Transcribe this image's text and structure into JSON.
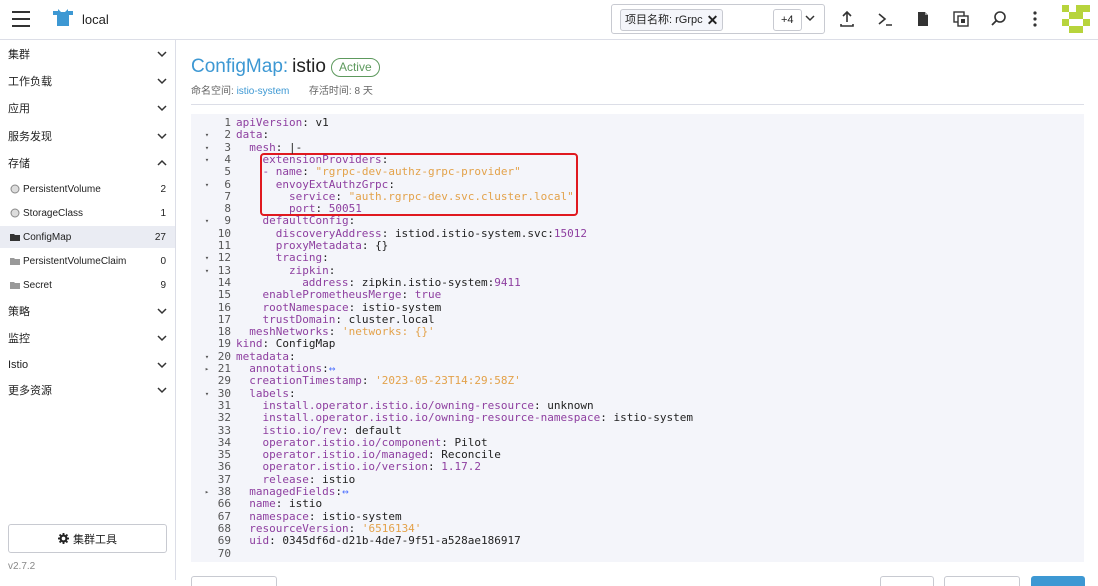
{
  "header": {
    "cluster_name": "local",
    "namespace_chip": "项目名称: rGrpc",
    "namespace_more": "+4"
  },
  "sidebar": {
    "groups": [
      {
        "label": "集群"
      },
      {
        "label": "工作负载"
      },
      {
        "label": "应用"
      },
      {
        "label": "服务发现"
      },
      {
        "label": "存储"
      }
    ],
    "storage_items": [
      {
        "label": "PersistentVolume",
        "count": "2"
      },
      {
        "label": "StorageClass",
        "count": "1"
      },
      {
        "label": "ConfigMap",
        "count": "27"
      },
      {
        "label": "PersistentVolumeClaim",
        "count": "0"
      },
      {
        "label": "Secret",
        "count": "9"
      }
    ],
    "groups_after": [
      {
        "label": "策略"
      },
      {
        "label": "监控"
      },
      {
        "label": "Istio"
      },
      {
        "label": "更多资源"
      }
    ],
    "tools_button": "集群工具",
    "version": "v2.7.2"
  },
  "page": {
    "kind": "ConfigMap:",
    "name": "istio",
    "status": "Active",
    "ns_label": "命名空间:",
    "ns_value": "istio-system",
    "age_label": "存活时间:",
    "age_value": "8 天"
  },
  "editor": {
    "lines": [
      {
        "n": "1",
        "fold": "",
        "indent": 0,
        "key": "apiVersion",
        "sep": ": ",
        "val": "v1",
        "vt": "p"
      },
      {
        "n": "2",
        "fold": "▾",
        "indent": 0,
        "key": "data",
        "sep": ":",
        "val": "",
        "vt": "p"
      },
      {
        "n": "3",
        "fold": "▾",
        "indent": 2,
        "key": "mesh",
        "sep": ": ",
        "val": "|-",
        "vt": "p"
      },
      {
        "n": "4",
        "fold": "▾",
        "indent": 4,
        "key": "extensionProviders",
        "sep": ":",
        "val": "",
        "vt": "p"
      },
      {
        "n": "5",
        "fold": "",
        "indent": 4,
        "key": "- name",
        "sep": ": ",
        "val": "\"rgrpc-dev-authz-grpc-provider\"",
        "vt": "s"
      },
      {
        "n": "6",
        "fold": "▾",
        "indent": 6,
        "key": "envoyExtAuthzGrpc",
        "sep": ":",
        "val": "",
        "vt": "p"
      },
      {
        "n": "7",
        "fold": "",
        "indent": 8,
        "key": "service",
        "sep": ": ",
        "val": "\"auth.rgrpc-dev.svc.cluster.local\"",
        "vt": "s"
      },
      {
        "n": "8",
        "fold": "",
        "indent": 8,
        "key": "port",
        "sep": ": ",
        "val": "50051",
        "vt": "n"
      },
      {
        "n": "9",
        "fold": "▾",
        "indent": 4,
        "key": "defaultConfig",
        "sep": ":",
        "val": "",
        "vt": "p"
      },
      {
        "n": "10",
        "fold": "",
        "indent": 6,
        "key": "discoveryAddress",
        "sep": ": ",
        "val": "istiod.istio-system.svc:",
        "vt": "p",
        "val2": "15012"
      },
      {
        "n": "11",
        "fold": "",
        "indent": 6,
        "key": "proxyMetadata",
        "sep": ": ",
        "val": "{}",
        "vt": "p"
      },
      {
        "n": "12",
        "fold": "▾",
        "indent": 6,
        "key": "tracing",
        "sep": ":",
        "val": "",
        "vt": "p"
      },
      {
        "n": "13",
        "fold": "▾",
        "indent": 8,
        "key": "zipkin",
        "sep": ":",
        "val": "",
        "vt": "p"
      },
      {
        "n": "14",
        "fold": "",
        "indent": 10,
        "key": "address",
        "sep": ": ",
        "val": "zipkin.istio-system:",
        "vt": "p",
        "val2": "9411"
      },
      {
        "n": "15",
        "fold": "",
        "indent": 4,
        "key": "enablePrometheusMerge",
        "sep": ": ",
        "val": "true",
        "vt": "n"
      },
      {
        "n": "16",
        "fold": "",
        "indent": 4,
        "key": "rootNamespace",
        "sep": ": ",
        "val": "istio-system",
        "vt": "p"
      },
      {
        "n": "17",
        "fold": "",
        "indent": 4,
        "key": "trustDomain",
        "sep": ": ",
        "val": "cluster.local",
        "vt": "p"
      },
      {
        "n": "18",
        "fold": "",
        "indent": 2,
        "key": "meshNetworks",
        "sep": ": ",
        "val": "'networks: {}'",
        "vt": "s"
      },
      {
        "n": "19",
        "fold": "",
        "indent": 0,
        "key": "kind",
        "sep": ": ",
        "val": "ConfigMap",
        "vt": "p"
      },
      {
        "n": "20",
        "fold": "▾",
        "indent": 0,
        "key": "metadata",
        "sep": ":",
        "val": "",
        "vt": "p"
      },
      {
        "n": "21",
        "fold": "▸",
        "indent": 2,
        "key": "annotations",
        "sep": ":",
        "val": "↔",
        "vt": "f"
      },
      {
        "n": "29",
        "fold": "",
        "indent": 2,
        "key": "creationTimestamp",
        "sep": ": ",
        "val": "'2023-05-23T14:29:58Z'",
        "vt": "s"
      },
      {
        "n": "30",
        "fold": "▾",
        "indent": 2,
        "key": "labels",
        "sep": ":",
        "val": "",
        "vt": "p"
      },
      {
        "n": "31",
        "fold": "",
        "indent": 4,
        "key": "install.operator.istio.io/owning-resource",
        "sep": ": ",
        "val": "unknown",
        "vt": "p"
      },
      {
        "n": "32",
        "fold": "",
        "indent": 4,
        "key": "install.operator.istio.io/owning-resource-namespace",
        "sep": ": ",
        "val": "istio-system",
        "vt": "p"
      },
      {
        "n": "33",
        "fold": "",
        "indent": 4,
        "key": "istio.io/rev",
        "sep": ": ",
        "val": "default",
        "vt": "p"
      },
      {
        "n": "34",
        "fold": "",
        "indent": 4,
        "key": "operator.istio.io/component",
        "sep": ": ",
        "val": "Pilot",
        "vt": "p"
      },
      {
        "n": "35",
        "fold": "",
        "indent": 4,
        "key": "operator.istio.io/managed",
        "sep": ": ",
        "val": "Reconcile",
        "vt": "p"
      },
      {
        "n": "36",
        "fold": "",
        "indent": 4,
        "key": "operator.istio.io/version",
        "sep": ": ",
        "val": "1.17.2",
        "vt": "n"
      },
      {
        "n": "37",
        "fold": "",
        "indent": 4,
        "key": "release",
        "sep": ": ",
        "val": "istio",
        "vt": "p"
      },
      {
        "n": "38",
        "fold": "▸",
        "indent": 2,
        "key": "managedFields",
        "sep": ":",
        "val": "↔",
        "vt": "f"
      },
      {
        "n": "66",
        "fold": "",
        "indent": 2,
        "key": "name",
        "sep": ": ",
        "val": "istio",
        "vt": "p"
      },
      {
        "n": "67",
        "fold": "",
        "indent": 2,
        "key": "namespace",
        "sep": ": ",
        "val": "istio-system",
        "vt": "p"
      },
      {
        "n": "68",
        "fold": "",
        "indent": 2,
        "key": "resourceVersion",
        "sep": ": ",
        "val": "'6516134'",
        "vt": "s"
      },
      {
        "n": "69",
        "fold": "",
        "indent": 2,
        "key": "uid",
        "sep": ": ",
        "val": "0345df6d-d21b-4de7-9f51-a528ae186917",
        "vt": "p"
      },
      {
        "n": "70",
        "fold": "",
        "indent": 0,
        "key": "",
        "sep": "",
        "val": "",
        "vt": "p"
      }
    ]
  },
  "colors": {
    "accent": "#3d98d3",
    "active_badge": "#5d995d",
    "highlight_box": "#e0191f",
    "yaml_key": "#8e3fa0",
    "yaml_string": "#e3a24a"
  }
}
